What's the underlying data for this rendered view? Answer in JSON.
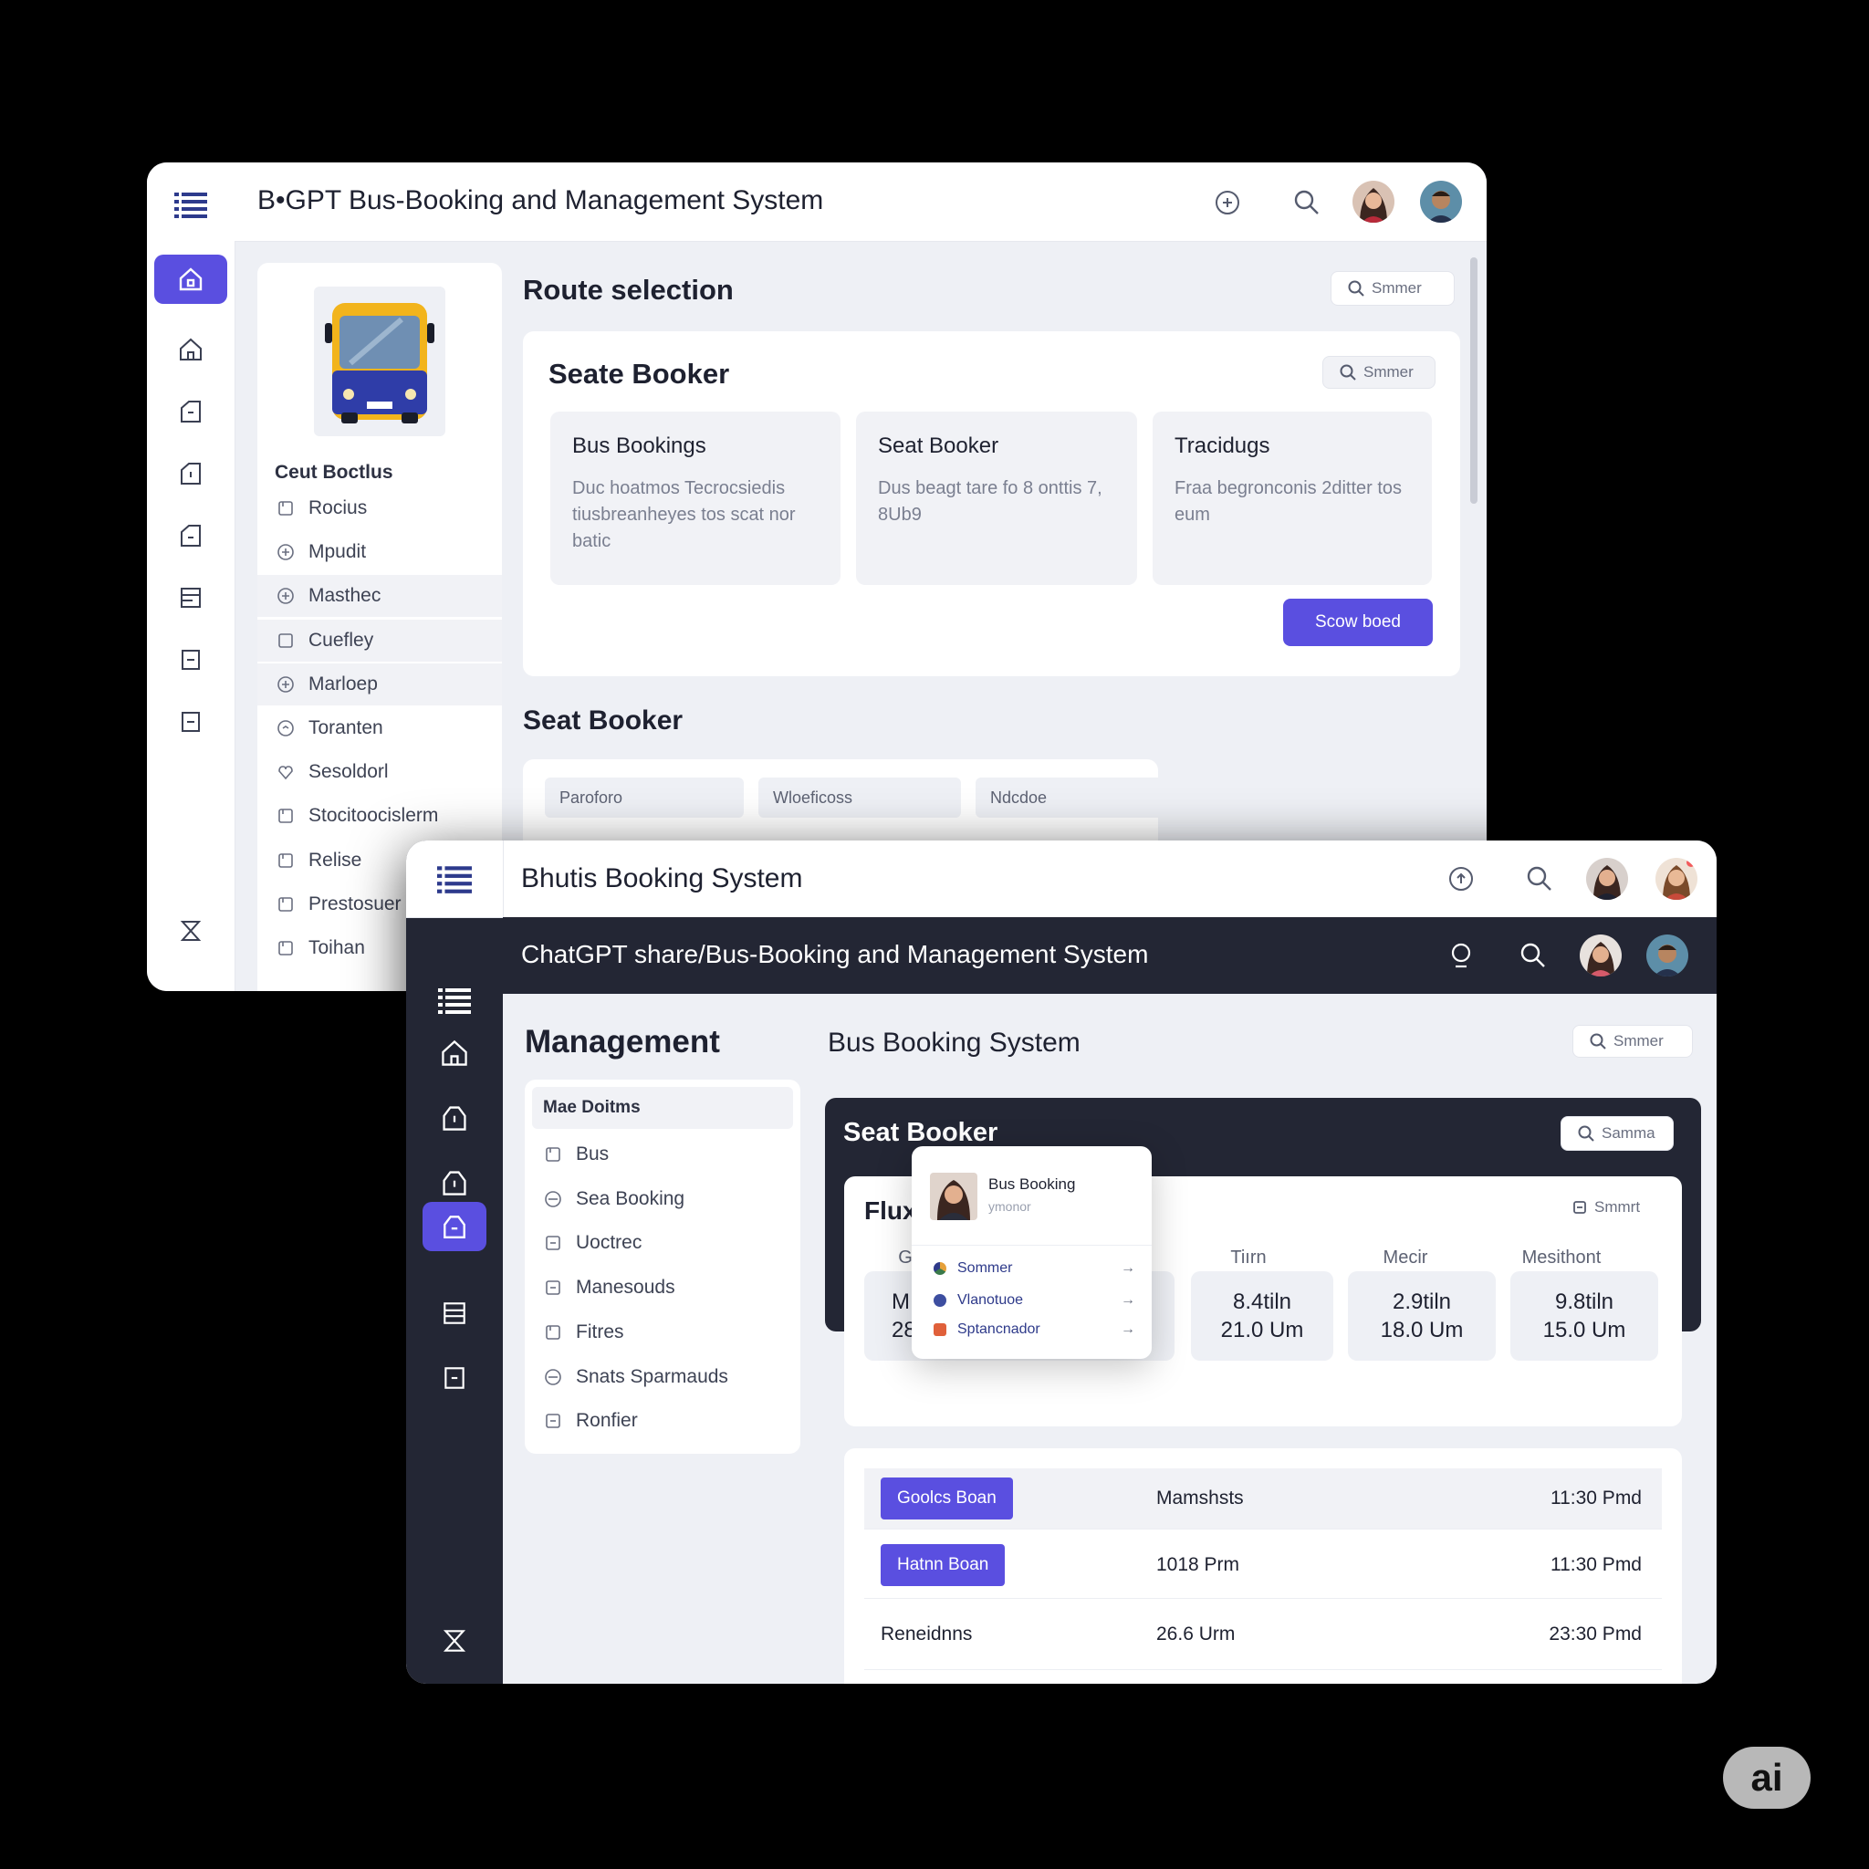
{
  "window_back": {
    "title": "B•GPT Bus-Booking and Management System",
    "section_title": "Route selection",
    "search_label": "Smmer",
    "card": {
      "title": "Seate Booker",
      "search_label": "Smmer",
      "tiles": [
        {
          "title": "Bus Bookings",
          "desc": "Duc hoatmos Tecrocsiedis tiusbreanheyes tos scat nor batic"
        },
        {
          "title": "Seat Booker",
          "desc": "Dus beagt tare fo 8 onttis 7, 8Ub9"
        },
        {
          "title": "Tracidugs",
          "desc": "Fraa begronconis 2ditter tos eum"
        }
      ],
      "action_label": "Scow boed"
    },
    "table_section_title": "Seat Booker",
    "table_headers": [
      "Paroforo",
      "Wloeficoss",
      "Ndcdoe"
    ],
    "side_panel": {
      "heading": "Ceut Boctlus",
      "items": [
        {
          "label": "Rocius",
          "icon": "doc-icon"
        },
        {
          "label": "Mpudit",
          "icon": "plus-circle-icon"
        },
        {
          "label": "Masthec",
          "icon": "plus-circle-icon"
        },
        {
          "label": "Cuefley",
          "icon": "square-icon"
        },
        {
          "label": "Marloep",
          "icon": "plus-circle-icon"
        },
        {
          "label": "Toranten",
          "icon": "clock-icon"
        },
        {
          "label": "Sesoldorl",
          "icon": "heart-icon"
        },
        {
          "label": "Stocitoocislerm",
          "icon": "doc-icon"
        },
        {
          "label": "Relise",
          "icon": "doc-icon"
        },
        {
          "label": "Prestosuer",
          "icon": "doc-icon"
        },
        {
          "label": "Toihan",
          "icon": "doc-icon"
        }
      ]
    }
  },
  "window_front": {
    "title_top": "Bhutis Booking System",
    "title_bar": "ChatGPT share/Bus-Booking and Management System",
    "sidebar_title": "Management",
    "sidebar_heading": "Mae Doitms",
    "sidebar_items": [
      "Bus",
      "Sea Booking",
      "Uoctrec",
      "Manesouds",
      "Fitres",
      "Snats Sparmauds",
      "Ronfier"
    ],
    "main_title": "Bus Booking System",
    "search_label": "Smmer",
    "seat_booker": {
      "title": "Seat Booker",
      "search_label": "Samma",
      "inner_title": "Flux",
      "inner_search_label": "Smmrt",
      "col_headers": [
        "G",
        "Tiırn",
        "Mecir",
        "Mesithont"
      ],
      "stats": [
        {
          "line1": "M",
          "line2": "28"
        },
        {
          "line1": "8.4tiln",
          "line2": "21.0 Um"
        },
        {
          "line1": "2.9tiln",
          "line2": "18.0 Um"
        },
        {
          "line1": "9.8tiln",
          "line2": "15.0 Um"
        }
      ]
    },
    "popup": {
      "title": "Bus Booking",
      "subtitle": "ymonor",
      "items": [
        "Sommer",
        "Vlanotuoe",
        "Sptancnador"
      ]
    },
    "rows": [
      {
        "c1": "Goolcs Boan",
        "c1_button": true,
        "c2": "Mamshsts",
        "c3": "11:30 Pmd"
      },
      {
        "c1": "Hatnn Boan",
        "c1_button": true,
        "c2": "1018 Prm",
        "c3": "11:30 Pmd"
      },
      {
        "c1": "Reneidnns",
        "c1_button": false,
        "c2": "26.6 Urm",
        "c3": "23:30 Pmd"
      }
    ]
  },
  "badge": "ai",
  "colors": {
    "accent": "#5a4fe0",
    "dark": "#232634",
    "bg": "#eef0f5"
  }
}
